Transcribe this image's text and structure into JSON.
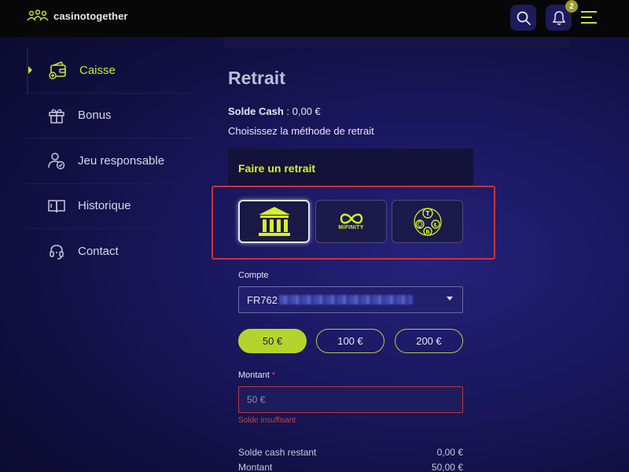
{
  "header": {
    "brand": "casinotogether",
    "notification_count": "2",
    "icons": {
      "search": "search-icon",
      "bell": "bell-icon",
      "menu": "hamburger-icon"
    }
  },
  "sidebar": {
    "items": [
      {
        "label": "Caisse",
        "icon": "wallet-icon",
        "active": true
      },
      {
        "label": "Bonus",
        "icon": "gift-icon",
        "active": false
      },
      {
        "label": "Jeu responsable",
        "icon": "user-check-icon",
        "active": false
      },
      {
        "label": "Historique",
        "icon": "book-icon",
        "active": false
      },
      {
        "label": "Contact",
        "icon": "headset-icon",
        "active": false
      }
    ]
  },
  "main": {
    "title": "Retrait",
    "balance_label": "Solde Cash",
    "balance_value": " : 0,00 €",
    "instruction": "Choisissez la méthode de retrait",
    "panel_title": "Faire un retrait",
    "methods": [
      {
        "name": "bank-transfer",
        "icon": "bank-icon",
        "selected": true
      },
      {
        "name": "mifinity",
        "label": "MiFINITY",
        "icon": "infinity-icon",
        "selected": false
      },
      {
        "name": "crypto",
        "icon": "crypto-coins-icon",
        "selected": false
      }
    ],
    "account_label": "Compte",
    "account_value": "FR762",
    "amount_chips": [
      "50 €",
      "100 €",
      "200 €"
    ],
    "selected_chip": "50 €",
    "amount_label": "Montant",
    "amount_required_mark": "*",
    "amount_value": "50 €",
    "amount_error": "Solde insuffisant",
    "summary": [
      {
        "label": "Solde cash restant",
        "value": "0,00 €"
      },
      {
        "label": "Montant",
        "value": "50,00 €"
      }
    ]
  },
  "colors": {
    "accent": "#c4e62c",
    "error": "#c9333c",
    "background": "#1a1860"
  }
}
